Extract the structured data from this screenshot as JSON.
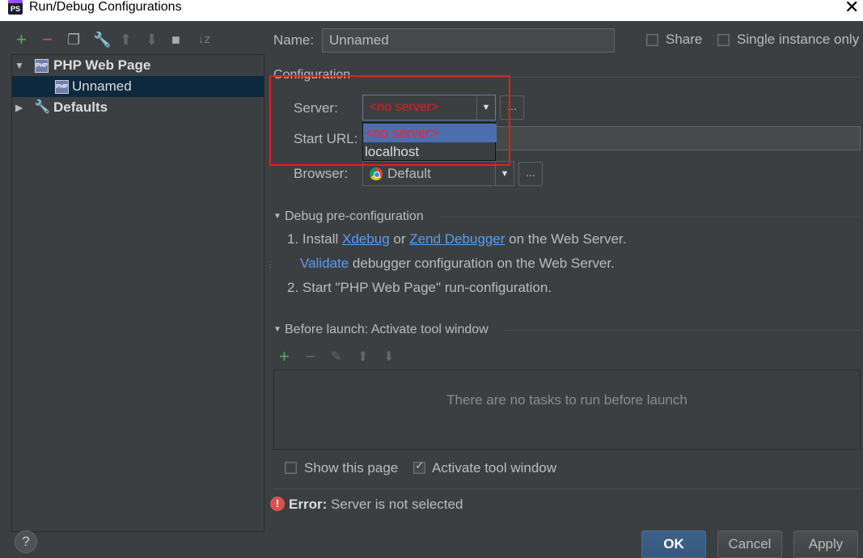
{
  "window": {
    "title": "Run/Debug Configurations",
    "app_icon_text": "PS"
  },
  "tree": {
    "items": [
      {
        "label": "PHP Web Page",
        "icon": "php-icon"
      },
      {
        "label": "Unnamed",
        "icon": "php-icon"
      },
      {
        "label": "Defaults",
        "icon": "wrench-icon"
      }
    ]
  },
  "form": {
    "name_label": "Name:",
    "name_value": "Unnamed",
    "share_label": "Share",
    "single_instance_label": "Single instance only",
    "configuration_title": "Configuration",
    "server_label": "Server:",
    "server_value": "<no server>",
    "start_url_label": "Start URL:",
    "browser_label": "Browser:",
    "browser_value": "Default",
    "dots": "..."
  },
  "server_dropdown": {
    "options": [
      "<no server>",
      "localhost"
    ]
  },
  "debug": {
    "title": "Debug pre-configuration",
    "step1_prefix": "1. Install",
    "xdebug": "Xdebug",
    "or": "or",
    "zend": "Zend Debugger",
    "step1_suffix": "on the Web Server.",
    "validate": "Validate",
    "validate_suffix": "debugger configuration on the Web Server.",
    "step2": "2. Start \"PHP Web Page\" run-configuration."
  },
  "before_launch": {
    "title": "Before launch: Activate tool window",
    "empty_text": "There are no tasks to run before launch",
    "show_page_label": "Show this page",
    "activate_label": "Activate tool window"
  },
  "error": {
    "bold": "Error:",
    "message": "Server is not selected"
  },
  "buttons": {
    "ok": "OK",
    "cancel": "Cancel",
    "apply": "Apply",
    "help": "?"
  },
  "colors": {
    "accent_red": "#e02020",
    "link": "#589df6",
    "selection": "#0d293e"
  }
}
